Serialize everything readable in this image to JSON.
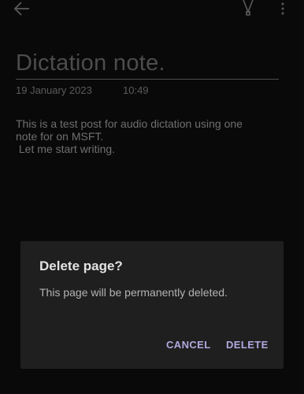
{
  "topbar": {
    "back_icon": "arrow-left-icon",
    "pen_icon": "pen-icon",
    "more_icon": "more-vertical-icon"
  },
  "note": {
    "title": "Dictation note.",
    "date": "19 January 2023",
    "time": "10:49",
    "body_lines": [
      "This is a test post for audio dictation using one",
      "note for on MSFT.",
      " Let me start writing."
    ]
  },
  "dialog": {
    "title": "Delete page?",
    "message": "This page will be permanently deleted.",
    "cancel_label": "CANCEL",
    "delete_label": "DELETE",
    "accent_color": "#b3a8de"
  }
}
